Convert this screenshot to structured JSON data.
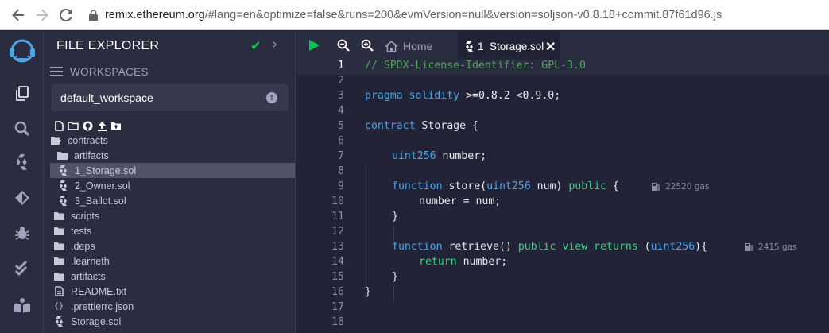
{
  "browser": {
    "url_host": "remix.ethereum.org",
    "url_rest": "/#lang=en&optimize=false&runs=200&evmVersion=null&version=soljson-v0.8.18+commit.87f61d96.js"
  },
  "side_panel": {
    "title": "FILE EXPLORER",
    "workspaces_label": "WORKSPACES",
    "workspace_selected": "default_workspace",
    "tree": [
      {
        "label": "contracts",
        "type": "folder-open"
      },
      {
        "label": "artifacts",
        "type": "folder"
      },
      {
        "label": "1_Storage.sol",
        "type": "sol",
        "selected": true
      },
      {
        "label": "2_Owner.sol",
        "type": "sol"
      },
      {
        "label": "3_Ballot.sol",
        "type": "sol"
      },
      {
        "label": "scripts",
        "type": "folder"
      },
      {
        "label": "tests",
        "type": "folder"
      },
      {
        "label": ".deps",
        "type": "folder"
      },
      {
        "label": ".learneth",
        "type": "folder"
      },
      {
        "label": "artifacts",
        "type": "folder"
      },
      {
        "label": "README.txt",
        "type": "file"
      },
      {
        "label": ".prettierrc.json",
        "type": "json"
      },
      {
        "label": "Storage.sol",
        "type": "sol"
      }
    ]
  },
  "editor": {
    "home_tab": "Home",
    "file_tab": "1_Storage.sol",
    "line_numbers": [
      "1",
      "2",
      "3",
      "4",
      "5",
      "6",
      "7",
      "8",
      "9",
      "10",
      "11",
      "12",
      "13",
      "14",
      "15",
      "16",
      "17",
      "18"
    ],
    "code": {
      "l1": "// SPDX-License-Identifier: GPL-3.0",
      "l3_kw": "pragma",
      "l3_kw2": "solidity",
      "l3_rest": " >=0.8.2 <0.9.0;",
      "l5_kw": "contract",
      "l5_rest": " Storage {",
      "l7_type": "uint256",
      "l7_rest": " number;",
      "l9_kw": "function",
      "l9_a": " store(",
      "l9_type": "uint256",
      "l9_b": " num) ",
      "l9_vis": "public",
      "l9_c": " {",
      "l10": "number = num;",
      "l11": "}",
      "l13_kw": "function",
      "l13_a": " retrieve() ",
      "l13_vis": "public",
      "l13_sp": " ",
      "l13_view": "view",
      "l13_sp2": " ",
      "l13_ret": "returns",
      "l13_b": " (",
      "l13_type": "uint256",
      "l13_c": "){",
      "l14_kw": "return",
      "l14_rest": " number;",
      "l15": "}",
      "l16": "}"
    },
    "gas_store": "22520 gas",
    "gas_retrieve": "2415 gas"
  }
}
